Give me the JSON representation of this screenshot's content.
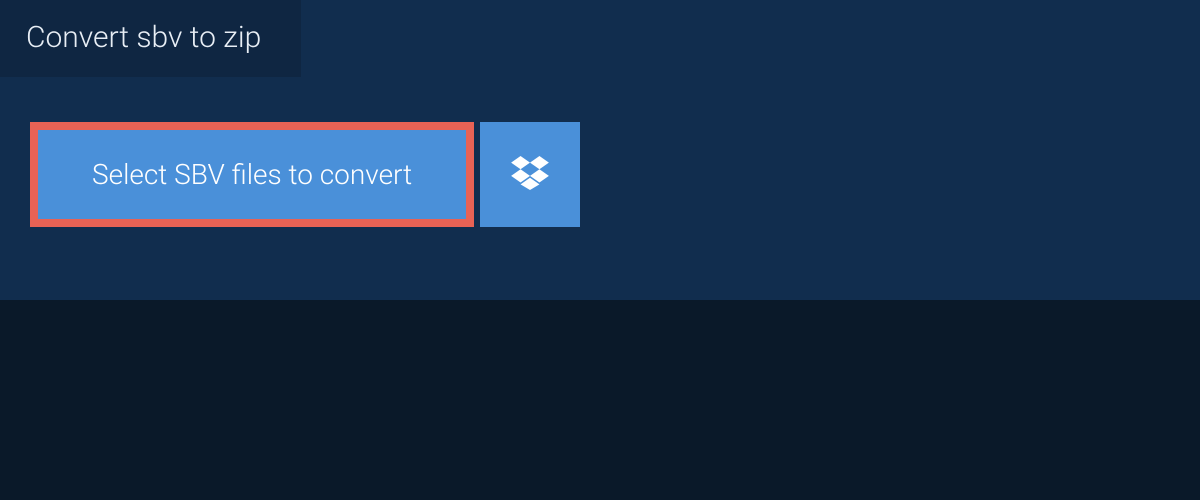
{
  "tab": {
    "title": "Convert sbv to zip"
  },
  "buttons": {
    "select_label": "Select SBV files to convert"
  },
  "colors": {
    "bg_dark": "#0a1929",
    "panel": "#112d4e",
    "tab_bg": "#0f2642",
    "button_blue": "#4a90d9",
    "highlight_border": "#e86255",
    "text_light": "#e8eef5"
  }
}
